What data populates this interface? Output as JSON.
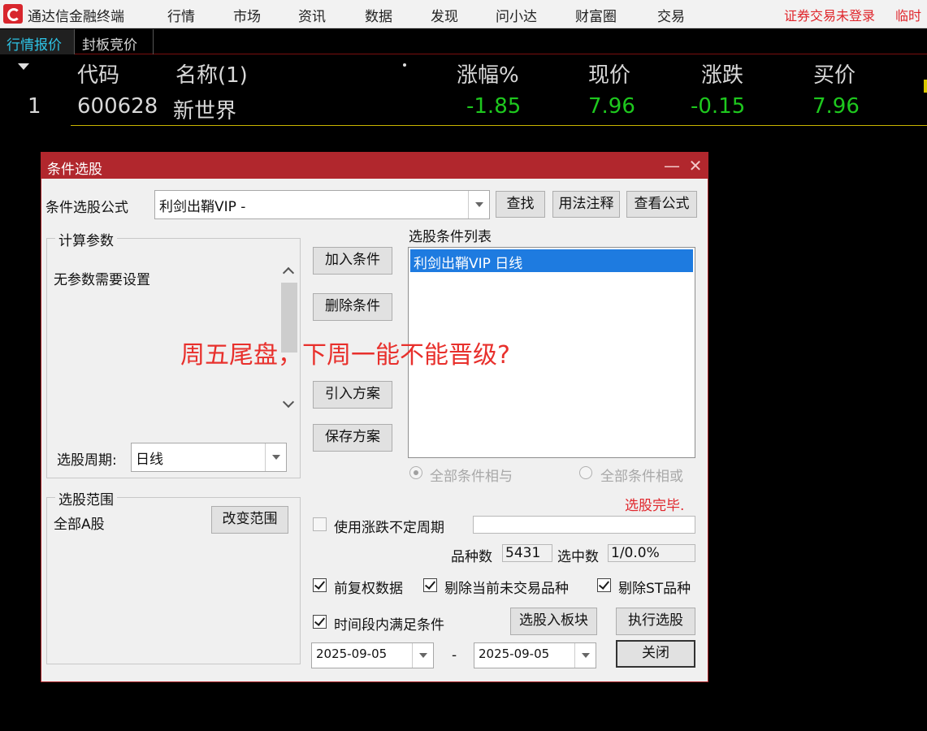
{
  "app": {
    "title": "通达信金融终端",
    "menu": [
      "行情",
      "市场",
      "资讯",
      "数据",
      "发现",
      "问小达",
      "财富圈",
      "交易"
    ],
    "login_status": "证券交易未登录",
    "temp_text": "临时",
    "brand_color": "#d8262d"
  },
  "tabs": [
    "行情报价",
    "封板竞价"
  ],
  "quote_table": {
    "headers": {
      "code": "代码",
      "name": "名称(1)",
      "dot": "•",
      "change_pct": "涨幅%",
      "price": "现价",
      "change": "涨跌",
      "bid": "买价"
    },
    "rows": [
      {
        "index": "1",
        "code": "600628",
        "name": "新世界",
        "change_pct": "-1.85",
        "price": "7.96",
        "change": "-0.15",
        "bid": "7.96"
      }
    ],
    "value_color": "#1ec81e"
  },
  "dialog": {
    "title": "条件选股",
    "minimize": "—",
    "close": "✕",
    "formula_label": "条件选股公式",
    "formula_value": "利剑出鞘VIP  -",
    "btn_find": "查找",
    "btn_usage": "用法注释",
    "btn_view_formula": "查看公式",
    "params_group": "计算参数",
    "params_text": "无参数需要设置",
    "period_label": "选股周期:",
    "period_value": "日线",
    "btn_add": "加入条件",
    "btn_delete": "删除条件",
    "btn_import": "引入方案",
    "btn_save": "保存方案",
    "conditions_label": "选股条件列表",
    "conditions": [
      "利剑出鞘VIP  日线"
    ],
    "radio_and": "全部条件相与",
    "radio_or": "全部条件相或",
    "radio_selected": "and",
    "status": "选股完毕.",
    "range_group": "选股范围",
    "range_value": "全部A股",
    "btn_change_range": "改变范围",
    "use_uncertain_period": "使用涨跌不定周期",
    "count_label": "品种数",
    "count_value": "5431",
    "selected_label": "选中数",
    "selected_value": "1/0.0%",
    "chk_forward_adjusted": "前复权数据",
    "chk_exclude_untraded": "剔除当前未交易品种",
    "chk_exclude_st": "剔除ST品种",
    "chk_time_range": "时间段内满足条件",
    "btn_to_block": "选股入板块",
    "btn_execute": "执行选股",
    "btn_close": "关闭",
    "date_from": "2025-09-05",
    "date_sep": "-",
    "date_to": "2025-09-05"
  },
  "overlay_question": "周五尾盘，下周一能不能晋级?"
}
